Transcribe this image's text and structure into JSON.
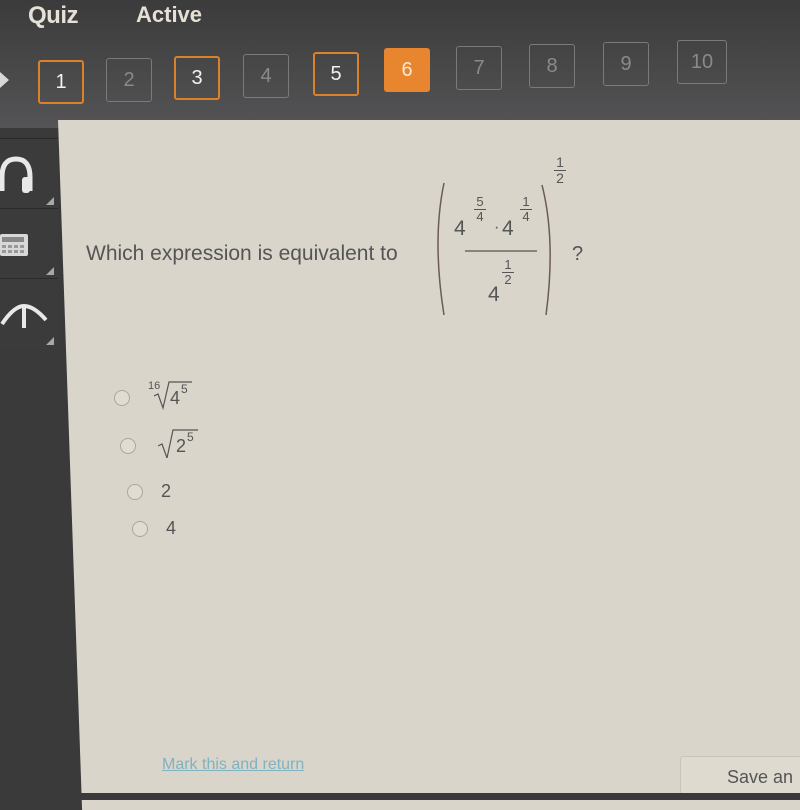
{
  "header": {
    "title": "Quiz",
    "status": "Active"
  },
  "question_nav": [
    {
      "label": "1",
      "state": "answered"
    },
    {
      "label": "2",
      "state": "unanswered"
    },
    {
      "label": "3",
      "state": "answered"
    },
    {
      "label": "4",
      "state": "unanswered"
    },
    {
      "label": "5",
      "state": "answered"
    },
    {
      "label": "6",
      "state": "current"
    },
    {
      "label": "7",
      "state": "unanswered"
    },
    {
      "label": "8",
      "state": "unanswered"
    },
    {
      "label": "9",
      "state": "unanswered"
    },
    {
      "label": "10",
      "state": "unanswered"
    }
  ],
  "sidebar": {
    "tools": [
      {
        "icon": "headphones-icon"
      },
      {
        "icon": "calculator-icon"
      },
      {
        "icon": "reference-icon"
      }
    ]
  },
  "question": {
    "prompt": "Which expression is equivalent to",
    "suffix": "?",
    "expression": {
      "base1": "4",
      "exp1_num": "5",
      "exp1_den": "4",
      "dot": "·",
      "base2": "4",
      "exp2_num": "1",
      "exp2_den": "4",
      "base3": "4",
      "exp3_num": "1",
      "exp3_den": "2",
      "outer_num": "1",
      "outer_den": "2"
    }
  },
  "choices": [
    {
      "type": "radical",
      "index": "16",
      "base": "4",
      "power": "5"
    },
    {
      "type": "radical",
      "index": "",
      "base": "2",
      "power": "5"
    },
    {
      "type": "plain",
      "text": "2"
    },
    {
      "type": "plain",
      "text": "4"
    }
  ],
  "footer": {
    "mark_link": "Mark this and return",
    "save_button": "Save an"
  },
  "colors": {
    "accent": "#e8862f",
    "answered_border": "#d9822b",
    "content_bg": "#d9d5cb",
    "topbar_bg": "#4a4a4b"
  }
}
